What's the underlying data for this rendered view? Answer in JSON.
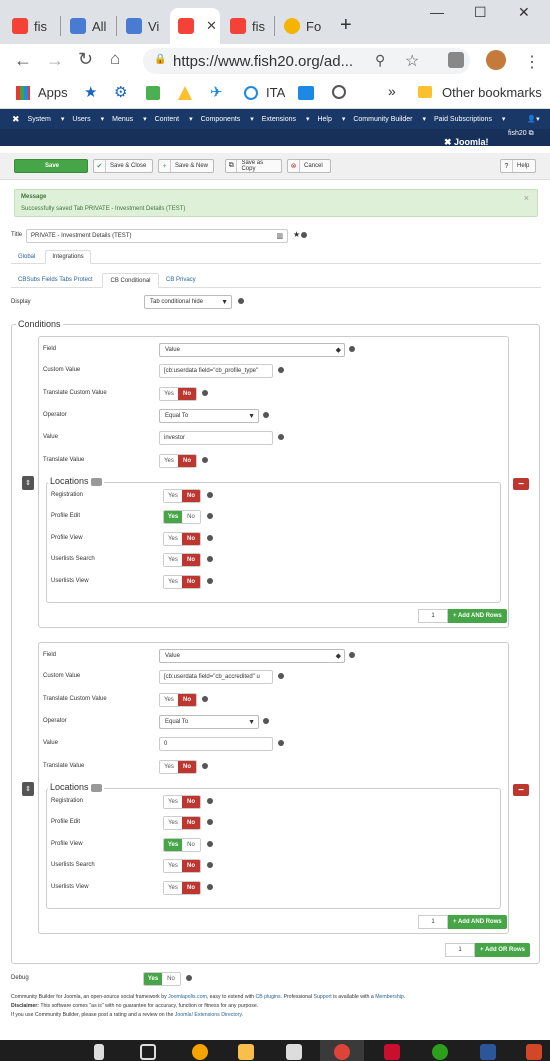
{
  "browser": {
    "tabs": [
      {
        "title": "fis",
        "icon": "joomla-icon"
      },
      {
        "title": "All",
        "icon": "cb-icon"
      },
      {
        "title": "Vi",
        "icon": "cb-icon"
      },
      {
        "title": "",
        "icon": "joomla-icon",
        "active": true
      },
      {
        "title": "fis",
        "icon": "joomla-icon"
      },
      {
        "title": "Fo",
        "icon": "forum-icon"
      }
    ],
    "url": "https://www.fish20.org/ad...",
    "bookmarks": {
      "apps": "Apps",
      "ita": "ITA",
      "other": "Other bookmarks"
    },
    "window_controls": {
      "minimize": "—",
      "maximize": "☐",
      "close": "✕"
    }
  },
  "joomla": {
    "nav": [
      "System",
      "Users",
      "Menus",
      "Content",
      "Components",
      "Extensions",
      "Help",
      "Community Builder",
      "Paid Subscriptions"
    ],
    "user_label": "fish20",
    "toolbar": {
      "save": "Save",
      "save_close": "Save & Close",
      "save_new": "Save & New",
      "save_copy": "Save as Copy",
      "cancel": "Cancel",
      "help": "Help"
    },
    "message": {
      "heading": "Message",
      "text": "Successfully saved Tab PRIVATE - Investment Details (TEST)"
    },
    "title_label": "Title",
    "title_value": "PRIVATE - Investment Details (TEST)",
    "tabs": {
      "global": "Global",
      "integrations": "Integrations"
    },
    "subtabs": {
      "protect": "CBSubs Fields Tabs Protect",
      "conditional": "CB Conditional",
      "privacy": "CB Privacy"
    },
    "display_label": "Display",
    "display_value": "Tab conditional hide",
    "conditions_label": "Conditions",
    "labels": {
      "field": "Field",
      "custom_value": "Custom Value",
      "translate_custom": "Translate Custom Value",
      "operator": "Operator",
      "value": "Value",
      "translate_value": "Translate Value",
      "locations": "Locations",
      "yes": "Yes",
      "no": "No",
      "add_and": "+ Add AND Rows",
      "add_or": "+ Add OR Rows"
    },
    "loc_names": [
      "Registration",
      "Profile Edit",
      "Profile View",
      "Userlists Search",
      "Userlists View"
    ],
    "conditions": [
      {
        "field": "Value",
        "custom_value": "[cb:userdata field=\"cb_profile_type\"",
        "translate_custom": "No",
        "operator": "Equal To",
        "value": "investor",
        "translate_value": "No",
        "locations": [
          "No",
          "Yes",
          "No",
          "No",
          "No"
        ],
        "and_rows": "1"
      },
      {
        "field": "Value",
        "custom_value": "[cb:userdata field=\"cb_accredited\" u",
        "translate_custom": "No",
        "operator": "Equal To",
        "value": "0",
        "translate_value": "No",
        "locations": [
          "No",
          "No",
          "Yes",
          "No",
          "No"
        ],
        "and_rows": "1"
      }
    ],
    "or_rows": "1",
    "debug_label": "Debug",
    "debug_value": "Yes",
    "footer": {
      "l1a": "Community Builder for Joomla, an open-source social framework by ",
      "l1b": "Joomlapolis.com",
      "l1c": ", easy to extend with ",
      "l1d": "CB plugins",
      "l1e": ". Professional ",
      "l1f": "Support",
      "l1g": " is available with a ",
      "l1h": "Membership",
      "l1i": ".",
      "l2a": "Disclaimer:",
      "l2b": " This software comes \"as is\" with no guarantee for accuracy, function or fitness for any purpose.",
      "l3a": "If you use Community Builder, please post a rating and a review on the ",
      "l3b": "Joomla! Extensions Directory",
      "l3c": "."
    }
  },
  "colors": {
    "joomla_nav": "#1a3867",
    "green": "#46a546",
    "red": "#bd362f"
  }
}
